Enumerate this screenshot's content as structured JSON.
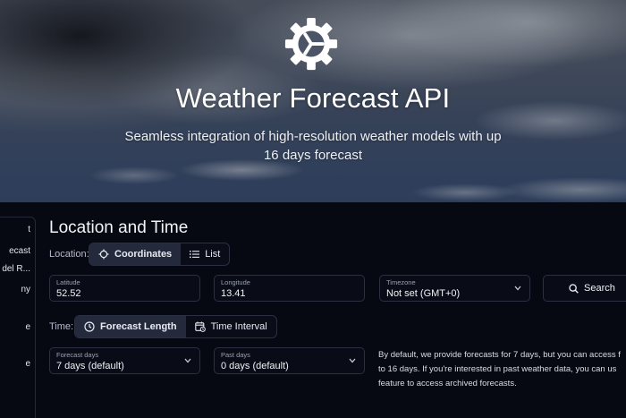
{
  "hero": {
    "title": "Weather Forecast API",
    "subtitle": "Seamless integration of high-resolution weather models with up 16 days forecast",
    "logo_icon": "gear-icon"
  },
  "sidebar": {
    "items": [
      {
        "label": "t"
      },
      {
        "label": "ecast"
      },
      {
        "label": "del R..."
      },
      {
        "label": "ny"
      },
      {
        "label": "e"
      },
      {
        "label": "e"
      }
    ]
  },
  "section": {
    "title": "Location and Time"
  },
  "location": {
    "label": "Location:",
    "tabs": [
      {
        "label": "Coordinates",
        "icon": "crosshair-icon",
        "active": true
      },
      {
        "label": "List",
        "icon": "list-icon",
        "active": false
      }
    ],
    "latitude": {
      "label": "Latitude",
      "value": "52.52"
    },
    "longitude": {
      "label": "Longitude",
      "value": "13.41"
    },
    "timezone": {
      "label": "Timezone",
      "value": "Not set (GMT+0)"
    },
    "search_label": "Search"
  },
  "time": {
    "label": "Time:",
    "tabs": [
      {
        "label": "Forecast Length",
        "icon": "clock-icon",
        "active": true
      },
      {
        "label": "Time Interval",
        "icon": "calendar-clock-icon",
        "active": false
      }
    ],
    "forecast_days": {
      "label": "Forecast days",
      "value": "7 days (default)"
    },
    "past_days": {
      "label": "Past days",
      "value": "0 days (default)"
    },
    "note_lines": [
      "By default, we provide forecasts for 7 days, but you can access f",
      "to 16 days. If you're interested in past weather data, you can us",
      "feature to access archived forecasts."
    ]
  },
  "colors": {
    "background": "#070912",
    "active_tab": "#242a3c",
    "border": "#2a3042"
  }
}
